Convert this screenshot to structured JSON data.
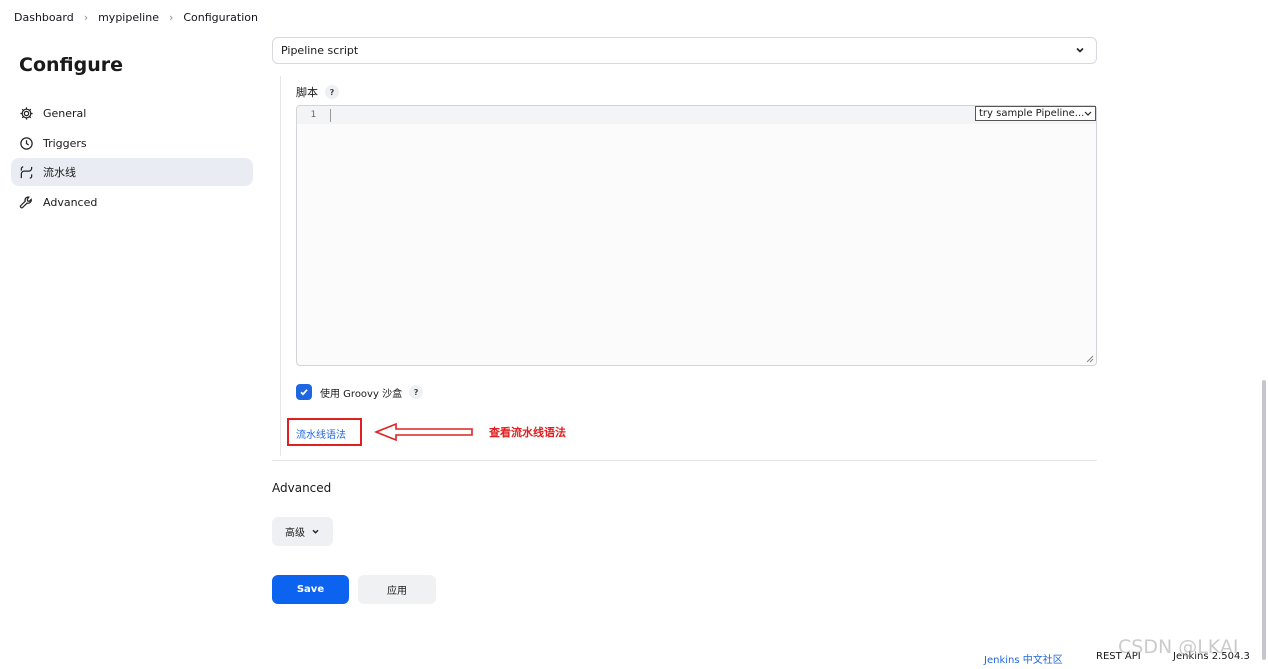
{
  "breadcrumb": {
    "items": [
      "Dashboard",
      "mypipeline",
      "Configuration"
    ]
  },
  "sidebar": {
    "title": "Configure",
    "items": [
      {
        "label": "General",
        "icon": "gear-icon"
      },
      {
        "label": "Triggers",
        "icon": "clock-icon"
      },
      {
        "label": "流水线",
        "icon": "pipeline-icon",
        "active": true
      },
      {
        "label": "Advanced",
        "icon": "wrench-icon"
      }
    ]
  },
  "pipeline": {
    "definition_value": "Pipeline script",
    "script_label": "脚本",
    "help_glyph": "?",
    "line_number": "1",
    "sample_select_value": "try sample Pipeline...",
    "sandbox_label": "使用 Groovy 沙盒",
    "sandbox_checked": true,
    "syntax_link": "流水线语法",
    "annotation": "查看流水线语法"
  },
  "advanced": {
    "title": "Advanced",
    "button_label": "高级"
  },
  "actions": {
    "save_label": "Save",
    "apply_label": "应用"
  },
  "footer": {
    "community": "Jenkins 中文社区",
    "rest_api": "REST API",
    "version": "Jenkins 2.504.3"
  },
  "watermark": "CSDN @LKAI",
  "colors": {
    "primary": "#0b63f0",
    "link": "#1f67e0",
    "annotation_red": "#e02020",
    "active_nav_bg": "#e9ecf2"
  }
}
